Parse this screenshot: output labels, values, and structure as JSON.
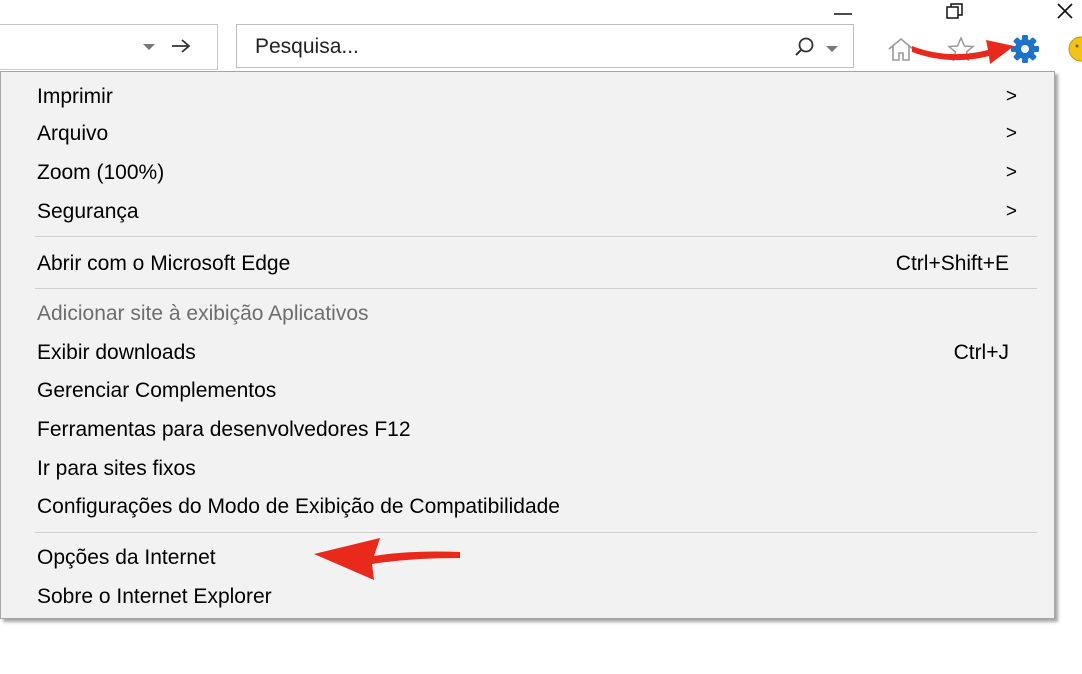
{
  "window_controls": {
    "minimize": "minimize-icon",
    "restore": "restore-icon",
    "close": "close-icon"
  },
  "address_bar": {
    "dropdown_icon": "chevron-down-icon",
    "go_icon": "arrow-right-icon"
  },
  "search": {
    "placeholder": "Pesquisa...",
    "search_icon": "search-icon",
    "dropdown_icon": "chevron-down-icon"
  },
  "toolbar": {
    "icons": [
      "home-icon",
      "favorites-star-icon",
      "gear-icon",
      "smiley-icon"
    ]
  },
  "menu": {
    "items": [
      {
        "label": "Imprimir",
        "shortcut": "",
        "submenu": ">"
      },
      {
        "label": "Arquivo",
        "shortcut": "",
        "submenu": ">"
      },
      {
        "label": "Zoom (100%)",
        "shortcut": "",
        "submenu": ">"
      },
      {
        "label": "Segurança",
        "shortcut": "",
        "submenu": ">"
      },
      {
        "label": "Abrir com o Microsoft Edge",
        "shortcut": "Ctrl+Shift+E"
      },
      {
        "label": "Adicionar site à exibição Aplicativos",
        "disabled": true
      },
      {
        "label": "Exibir downloads",
        "shortcut": "Ctrl+J"
      },
      {
        "label": "Gerenciar Complementos"
      },
      {
        "label": "Ferramentas para desenvolvedores F12"
      },
      {
        "label": "Ir para sites fixos"
      },
      {
        "label": "Configurações do Modo de Exibição de Compatibilidade"
      },
      {
        "label": "Opções da Internet"
      },
      {
        "label": "Sobre o Internet Explorer"
      }
    ]
  },
  "colors": {
    "menu_bg": "#f2f2f2",
    "annotation": "#e8291c",
    "gear": "#1e73c8",
    "disabled_text": "#6d6d6d"
  }
}
